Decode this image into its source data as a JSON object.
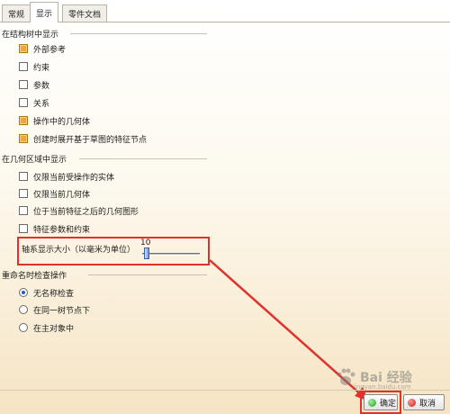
{
  "tabs": [
    {
      "label": "常规",
      "active": false
    },
    {
      "label": "显示",
      "active": true
    },
    {
      "label": "零件文档",
      "active": false
    }
  ],
  "tree_section": {
    "title": "在结构树中显示",
    "items": [
      {
        "label": "外部参考",
        "checked": true
      },
      {
        "label": "约束",
        "checked": false
      },
      {
        "label": "参数",
        "checked": false
      },
      {
        "label": "关系",
        "checked": false
      },
      {
        "label": "操作中的几何体",
        "checked": true
      },
      {
        "label": "创建时展开基于草图的特征节点",
        "checked": true
      }
    ]
  },
  "geometry_section": {
    "title": "在几何区域中显示",
    "items": [
      {
        "label": "仅限当前受操作的实体",
        "checked": false
      },
      {
        "label": "仅限当前几何体",
        "checked": false
      },
      {
        "label": "位于当前特征之后的几何图形",
        "checked": false
      },
      {
        "label": "特征参数和约束",
        "checked": false
      }
    ],
    "axis_size": {
      "label": "轴系显示大小（以毫米为单位）",
      "value": "10",
      "slider_fraction": 0.05
    }
  },
  "rename_section": {
    "title": "重命名时检查操作",
    "options": [
      {
        "label": "无名称检查",
        "selected": true
      },
      {
        "label": "在同一树节点下",
        "selected": false
      },
      {
        "label": "在主对象中",
        "selected": false
      }
    ]
  },
  "buttons": {
    "ok_label": "确定",
    "cancel_label": "取消"
  },
  "watermark": {
    "text": "Bai 经验",
    "sub": "jingyan.baidu.com"
  },
  "colors": {
    "annotation_red": "#e0322a",
    "checked_orange": "#f0a43a",
    "radio_blue": "#2d57c5"
  }
}
